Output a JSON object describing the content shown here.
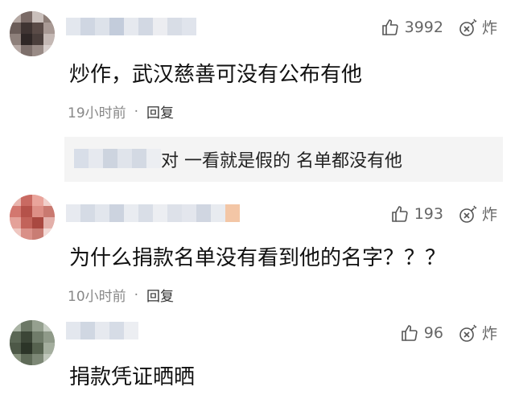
{
  "comments": [
    {
      "likes": "3992",
      "bomb_label": "炸",
      "text": "炒作，武汉慈善可没有公布有他",
      "time": "19小时前",
      "dot": "·",
      "reply": "回复",
      "sub_reply": {
        "text": "对 一看就是假的   名单都没有他"
      }
    },
    {
      "likes": "193",
      "bomb_label": "炸",
      "text": "为什么捐款名单没有看到他的名字？？？",
      "time": "10小时前",
      "dot": "·",
      "reply": "回复"
    },
    {
      "likes": "96",
      "bomb_label": "炸",
      "text": "捐款凭证晒晒"
    }
  ],
  "icons": {
    "like": "thumbs-up-icon",
    "bomb": "bomb-icon"
  }
}
